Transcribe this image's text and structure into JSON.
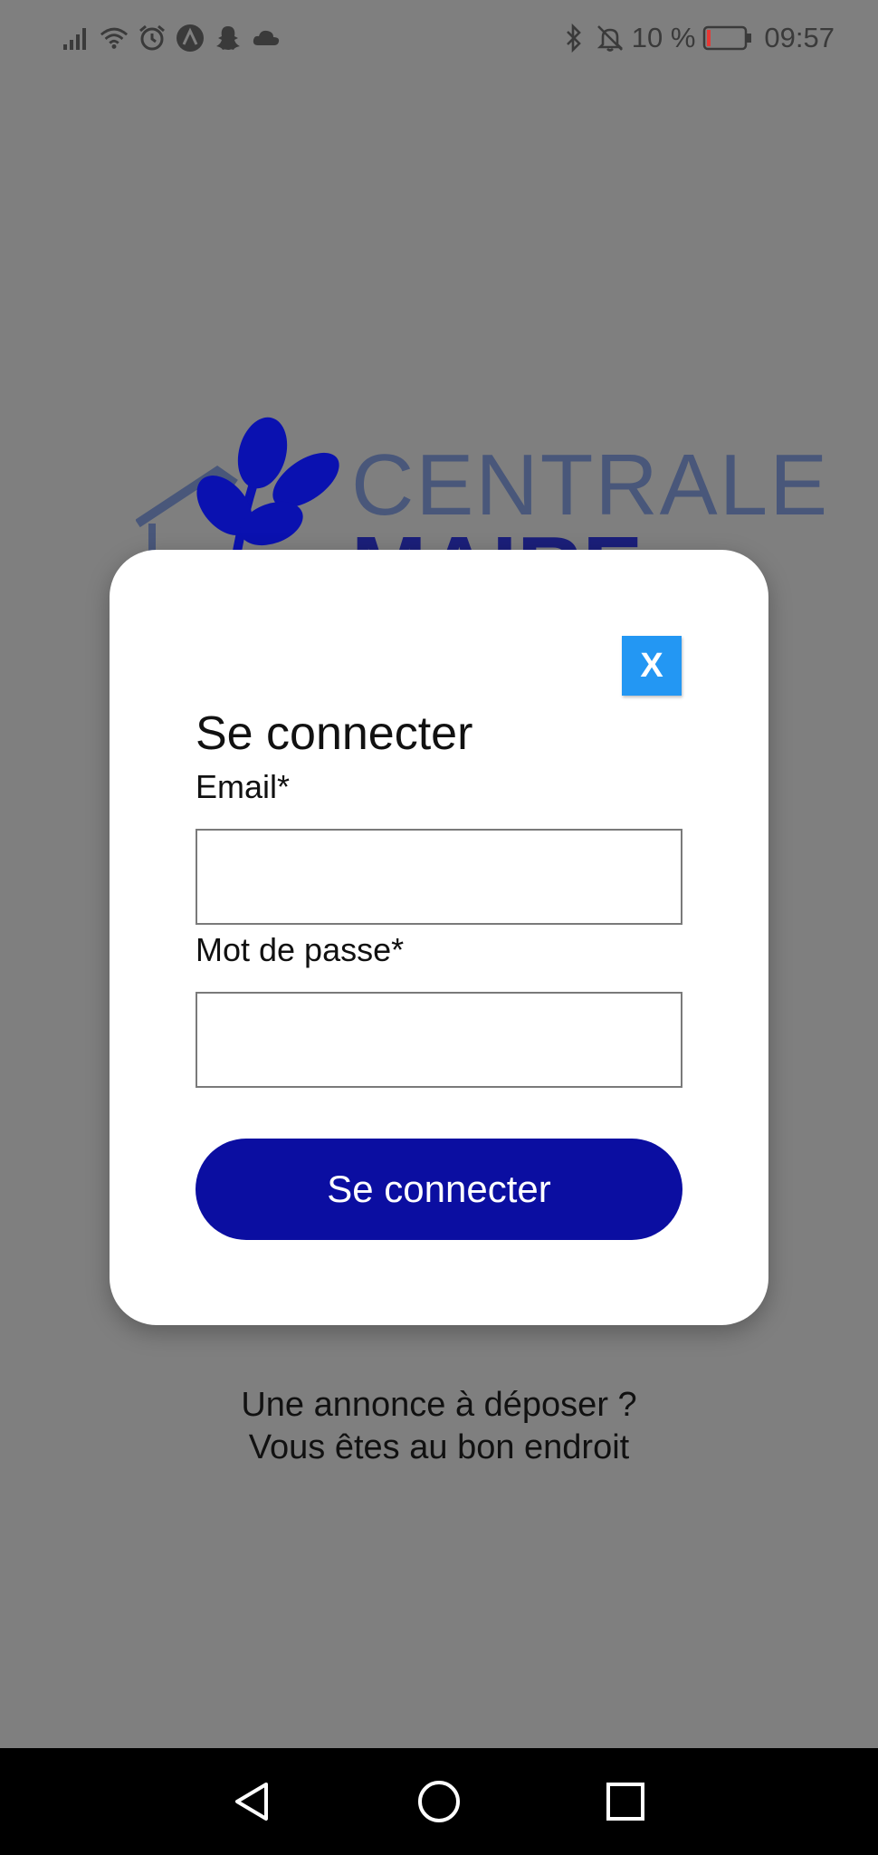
{
  "status_bar": {
    "left_icons": [
      "signal-icon",
      "wifi-icon",
      "alarm-icon",
      "app-notification-icon",
      "snapchat-icon",
      "cloud-icon"
    ],
    "right_icons": [
      "bluetooth-icon",
      "mute-icon",
      "battery-icon"
    ],
    "battery_text": "10 %",
    "battery_level": 0.1,
    "battery_color": "#e53935",
    "time": "09:57"
  },
  "logo": {
    "line1": "CENTRALE",
    "line2": "MAIRE",
    "colors": {
      "line1": "#49577a",
      "line2": "#1b1f7a",
      "leaves": "#0a11b0"
    }
  },
  "login_modal": {
    "close_label": "X",
    "title": "Se connecter",
    "email_label": "Email*",
    "email_value": "",
    "password_label": "Mot de passe*",
    "password_value": "",
    "submit_label": "Se connecter",
    "colors": {
      "close_button": "#2397f3",
      "submit_button": "#0b0ea1",
      "backdrop": "#7f7f7f"
    }
  },
  "tagline": {
    "line1": "Une annonce à déposer ?",
    "line2": "Vous êtes au bon endroit"
  },
  "nav_bar": {
    "buttons": [
      "back-icon",
      "home-icon",
      "recents-icon"
    ]
  }
}
